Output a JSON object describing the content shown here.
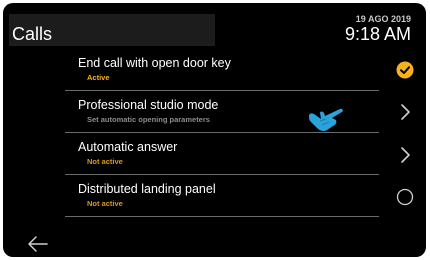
{
  "header": {
    "title": "Calls",
    "date": "19 AGO 2019",
    "time": "9:18 AM"
  },
  "colors": {
    "accent": "#f6b21a",
    "status_active": "#f6b21a",
    "status_inactive": "#d99a10",
    "hint": "#8c8c8c",
    "hand": "#29a3d9"
  },
  "settings": {
    "items": [
      {
        "label": "End call with open door key",
        "status": "Active",
        "control": "checked-circle-icon"
      },
      {
        "label": "Professional studio mode",
        "status": "Set automatic opening parameters",
        "control": "chevron-right-icon"
      },
      {
        "label": "Automatic answer",
        "status": "Not active",
        "control": "chevron-right-icon"
      },
      {
        "label": "Distributed landing panel",
        "status": "Not active",
        "control": "empty-circle-icon"
      }
    ]
  },
  "nav": {
    "back_icon": "back-arrow-icon"
  },
  "overlay": {
    "pointer_icon": "pointing-hand-icon"
  }
}
